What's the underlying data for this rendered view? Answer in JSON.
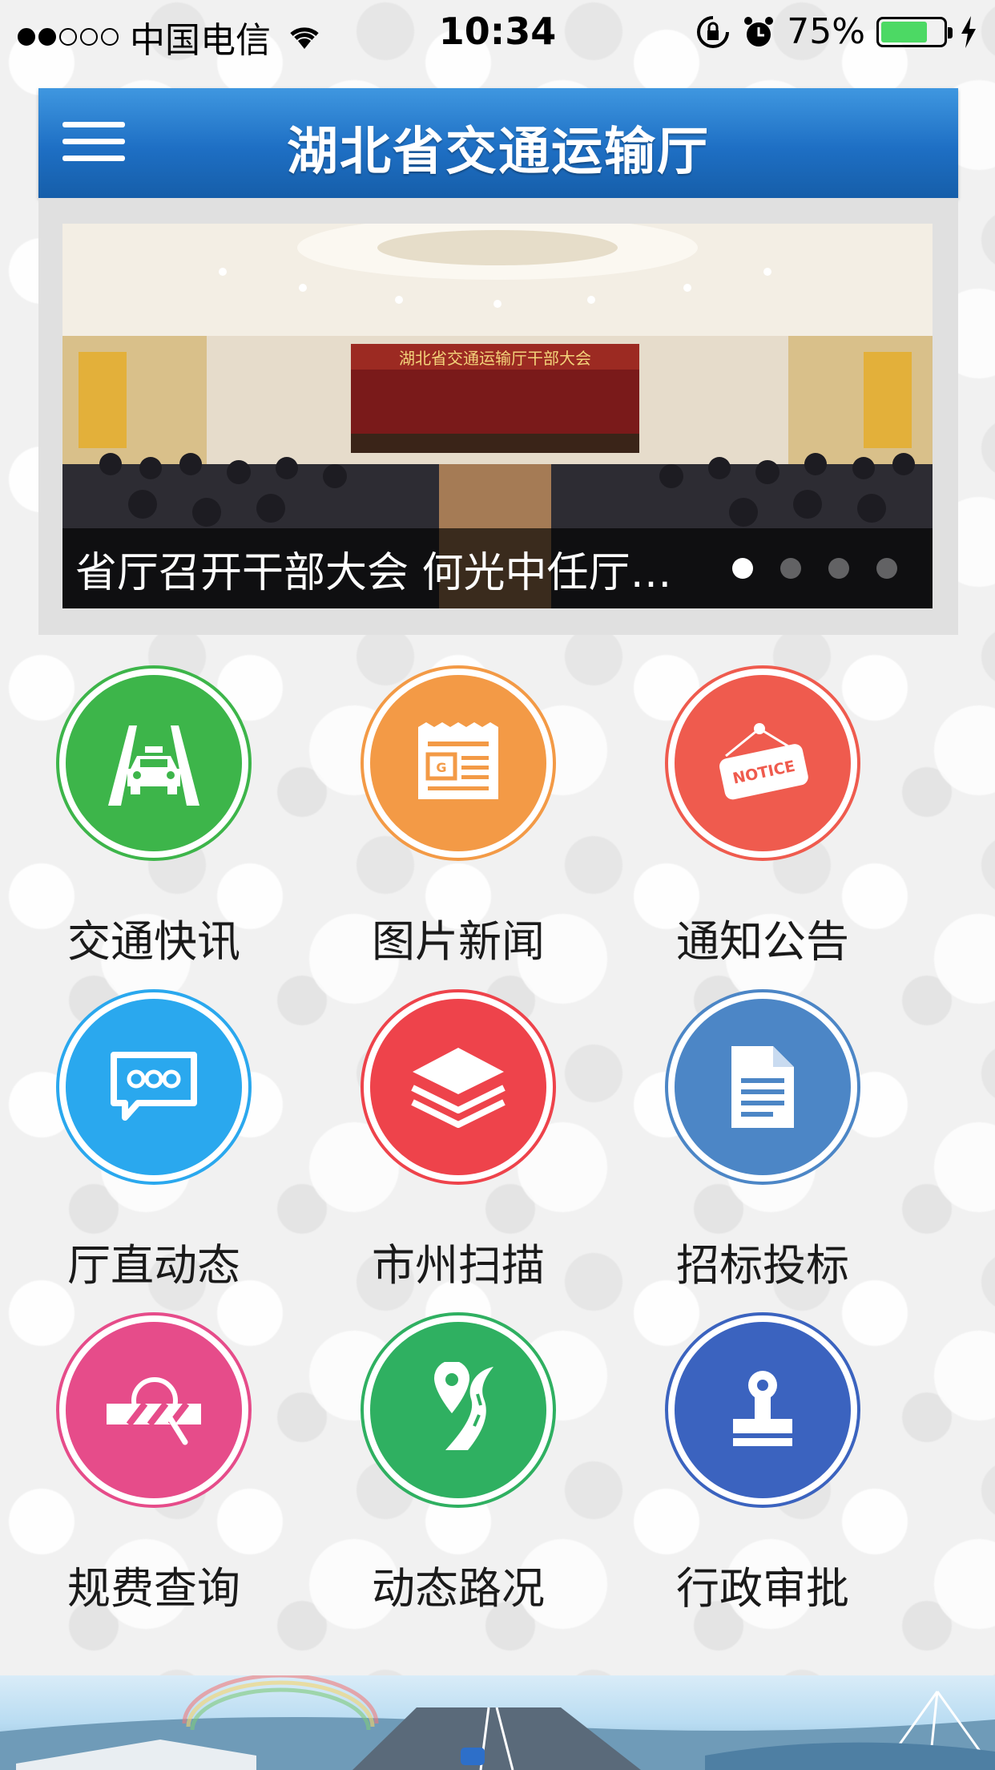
{
  "status_bar": {
    "carrier": "中国电信",
    "time": "10:34",
    "battery": "75%",
    "battery_level": 0.75,
    "icons": [
      "signal-dots",
      "wifi-icon",
      "orientation-lock-icon",
      "alarm-icon",
      "battery-icon",
      "charging-icon"
    ]
  },
  "header": {
    "title": "湖北省交通运输厅",
    "menu_icon": "hamburger-menu-icon"
  },
  "carousel": {
    "banner_text": "湖北省交通运输厅干部大会",
    "caption": "省厅召开干部大会 何光中任厅…",
    "page_count": 4,
    "active_page": 1
  },
  "grid": {
    "items": [
      {
        "label": "交通快讯",
        "icon": "taxi-road-icon",
        "color": "#3db54a"
      },
      {
        "label": "图片新闻",
        "icon": "newspaper-icon",
        "color": "#f39a46"
      },
      {
        "label": "通知公告",
        "icon": "notice-sign-icon",
        "color": "#ef5b4e"
      },
      {
        "label": "厅直动态",
        "icon": "chat-bubble-icon",
        "color": "#2aa8ee"
      },
      {
        "label": "市州扫描",
        "icon": "layers-icon",
        "color": "#ee434b"
      },
      {
        "label": "招标投标",
        "icon": "document-icon",
        "color": "#4c86c6"
      },
      {
        "label": "规费查询",
        "icon": "toll-barrier-icon",
        "color": "#e64c8a"
      },
      {
        "label": "动态路况",
        "icon": "road-location-icon",
        "color": "#2fb061"
      },
      {
        "label": "行政审批",
        "icon": "stamp-icon",
        "color": "#3b63bf"
      }
    ]
  }
}
